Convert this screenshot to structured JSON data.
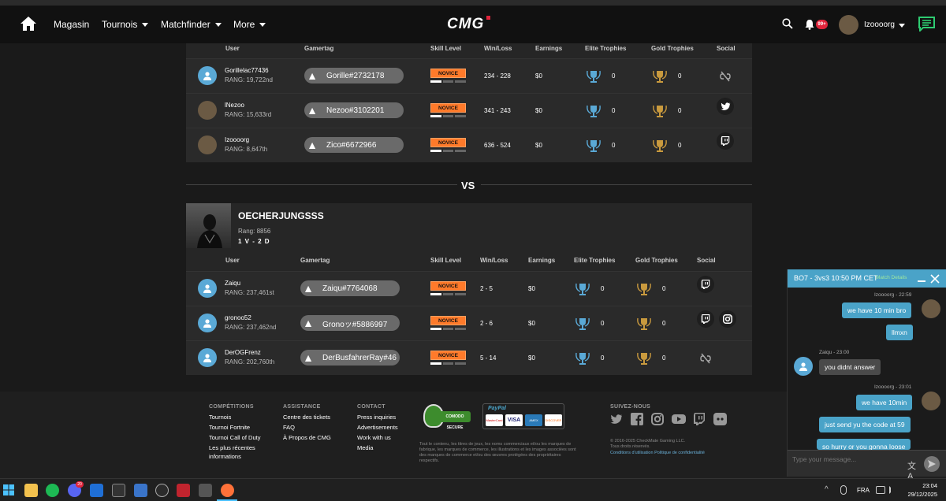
{
  "nav": {
    "items": [
      "Magasin",
      "Tournois",
      "Matchfinder",
      "More"
    ],
    "logo": "CMG",
    "notif_badge": "99+",
    "username": "Izoooorg"
  },
  "columns": {
    "user": "User",
    "gamertag": "Gamertag",
    "skill": "Skill Level",
    "winloss": "Win/Loss",
    "earnings": "Earnings",
    "elite": "Elite Trophies",
    "gold": "Gold Trophies",
    "social": "Social"
  },
  "team1": {
    "players": [
      {
        "name": "Gorillelac77436",
        "rank": "RANG: 19,722nd",
        "gamertag": "Gorille#2732178",
        "skill": "NOVICE",
        "wl": "234 - 228",
        "earnings": "$0",
        "elite": "0",
        "gold": "0",
        "social": [
          "unlink-icon"
        ]
      },
      {
        "name": "lNezoo",
        "rank": "RANG: 15,633rd",
        "gamertag": "Nezoo#3102201",
        "skill": "NOVICE",
        "wl": "341 - 243",
        "earnings": "$0",
        "elite": "0",
        "gold": "0",
        "social": [
          "twitter-icon"
        ]
      },
      {
        "name": "Izoooorg",
        "rank": "RANG: 8,647th",
        "gamertag": "Zico#6672966",
        "skill": "NOVICE",
        "wl": "636 - 524",
        "earnings": "$0",
        "elite": "0",
        "gold": "0",
        "social": [
          "twitch-icon"
        ]
      }
    ]
  },
  "vs": "VS",
  "team2": {
    "name": "OECHERJUNGSSS",
    "rank": "Rang: 8856",
    "record": "1 V - 2 D",
    "players": [
      {
        "name": "Zaiqu",
        "rank": "RANG: 237,461st",
        "gamertag": "Zaiqu#7764068",
        "skill": "NOVICE",
        "wl": "2 - 5",
        "earnings": "$0",
        "elite": "0",
        "gold": "0",
        "social": [
          "twitch-icon"
        ]
      },
      {
        "name": "gronoo52",
        "rank": "RANG: 237,462nd",
        "gamertag": "Gronoッ#5886997",
        "skill": "NOVICE",
        "wl": "2 - 6",
        "earnings": "$0",
        "elite": "0",
        "gold": "0",
        "social": [
          "twitch-icon",
          "instagram-icon"
        ]
      },
      {
        "name": "DerOGFrenz",
        "rank": "RANG: 202,760th",
        "gamertag": "DerBusfahrerRay#46",
        "skill": "NOVICE",
        "wl": "5 - 14",
        "earnings": "$0",
        "elite": "0",
        "gold": "0",
        "social": [
          "unlink-icon"
        ]
      }
    ]
  },
  "footer": {
    "competitions": {
      "title": "COMPÉTITIONS",
      "links": [
        "Tournois",
        "Tournoi Fortnite",
        "Tournoi Call of Duty",
        "Les plus récentes",
        "informations"
      ]
    },
    "assistance": {
      "title": "ASSISTANCE",
      "links": [
        "Centre des tickets",
        "FAQ",
        "À Propos de CMG"
      ]
    },
    "contact": {
      "title": "CONTACT",
      "links": [
        "Press inquiries",
        "Advertisements",
        "Work with us",
        "Media"
      ]
    },
    "follow": "SUIVEZ-NOUS",
    "secure": "COMODO SECURE",
    "paypal": "PayPal",
    "cards": [
      "MasterCard",
      "VISA",
      "AMEX",
      "DISCOVER"
    ],
    "legal": "Tout le contenu, les titres de jeux, les noms commerciaux et/ou les marques de fabrique, les marques de commerce, les illustrations et les images associées sont des marques de commerce et/ou des œuvres protégées des propriétaires respectifs.",
    "copyright": "© 2016-2025 CheckMate Gaming LLC.",
    "rights": "Tous droits réservés.",
    "terms": "Conditions d'utilisation Politique de confidentialité"
  },
  "chat": {
    "title": "BO7 - 3vs3 10:50 PM CET",
    "details": "Match Details",
    "messages": [
      {
        "from": "me",
        "meta": "Izoooorg - 22:59",
        "texts": [
          "we have 10 min bro",
          "llmxn"
        ]
      },
      {
        "from": "them",
        "meta": "Zaiqu - 23:00",
        "texts": [
          "you didnt answer"
        ]
      },
      {
        "from": "me",
        "meta": "Izoooorg - 23:01",
        "texts": [
          "we have 10min",
          "just send yu the code at 59",
          "so hurry or you gonna loose"
        ]
      }
    ],
    "placeholder": "Type your message..."
  },
  "taskbar": {
    "lang": "FRA",
    "time": "23:04",
    "date": "29/12/2025",
    "discord_badge": "20"
  },
  "colors": {
    "accent": "#4aa3c8",
    "novice": "#ff7a2a",
    "notif": "#e0243b",
    "chat_icon": "#2ecc71"
  }
}
